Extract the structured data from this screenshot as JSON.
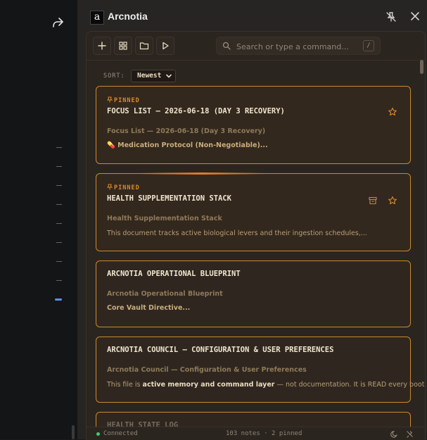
{
  "app": {
    "title": "Arcnotia",
    "logo_letter": "a"
  },
  "toolbar": {
    "new": "add-icon",
    "grid": "grid-icon",
    "folder": "folder-icon",
    "run": "play-icon"
  },
  "search": {
    "placeholder": "Search or type a command...",
    "shortcut": "/"
  },
  "sort": {
    "label": "SORT:",
    "selected": "Newest"
  },
  "cards": [
    {
      "pinned": true,
      "pin_label": "PINNED",
      "title": "FOCUS LIST — 2026-06-18 (DAY 3 RECOVERY)",
      "subtitle": "Focus List — 2026-06-18 (Day 3 Recovery)",
      "preview": "💊 Medication Protocol (Non-Negotiable)..."
    },
    {
      "pinned": true,
      "pin_label": "PINNED",
      "title": "HEALTH SUPPLEMENTATION STACK",
      "subtitle": "Health Supplementation Stack",
      "preview": "This document tracks active biological levers and their ingestion schedules,..."
    },
    {
      "pinned": false,
      "title": "ARCNOTIA OPERATIONAL BLUEPRINT",
      "subtitle": "Arcnotia Operational Blueprint",
      "preview": "Core Vault Directive..."
    },
    {
      "pinned": false,
      "title": "ARCNOTIA COUNCIL — CONFIGURATION & USER PREFERENCES",
      "subtitle": "Arcnotia Council — Configuration & User Preferences",
      "preview_prefix": "This file is ",
      "preview_bold": "active memory and command layer",
      "preview_suffix": " — not documentation. It is READ every boot..."
    },
    {
      "pinned": false,
      "title": "HEALTH STATE LOG"
    }
  ],
  "footer": {
    "status": "Connected",
    "counts": "103 notes · 2 pinned"
  },
  "colors": {
    "accent": "#d98a2c",
    "card_border": "#c9882f",
    "connected": "#3ccf6a",
    "left_indicator": "#5b8ff0"
  }
}
